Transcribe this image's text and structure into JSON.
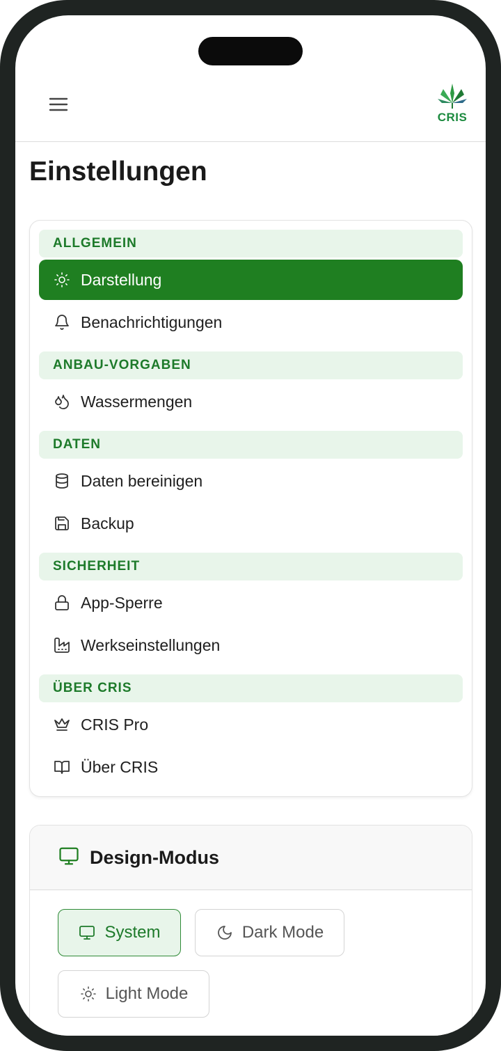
{
  "header": {
    "logo_text": "CRIS"
  },
  "page": {
    "title": "Einstellungen"
  },
  "menu": {
    "sections": [
      {
        "label": "ALLGEMEIN",
        "items": [
          {
            "label": "Darstellung",
            "icon": "sun-icon",
            "active": true
          },
          {
            "label": "Benachrichtigungen",
            "icon": "bell-icon"
          }
        ]
      },
      {
        "label": "ANBAU-VORGABEN",
        "items": [
          {
            "label": "Wassermengen",
            "icon": "droplets-icon"
          }
        ]
      },
      {
        "label": "DATEN",
        "items": [
          {
            "label": "Daten bereinigen",
            "icon": "database-icon"
          },
          {
            "label": "Backup",
            "icon": "save-icon"
          }
        ]
      },
      {
        "label": "SICHERHEIT",
        "items": [
          {
            "label": "App-Sperre",
            "icon": "lock-icon"
          },
          {
            "label": "Werkseinstellungen",
            "icon": "factory-icon"
          }
        ]
      },
      {
        "label": "ÜBER CRIS",
        "items": [
          {
            "label": "CRIS Pro",
            "icon": "crown-icon"
          },
          {
            "label": "Über CRIS",
            "icon": "book-icon"
          }
        ]
      }
    ]
  },
  "design_mode": {
    "title": "Design-Modus",
    "options": [
      {
        "label": "System",
        "icon": "monitor-icon",
        "selected": true
      },
      {
        "label": "Dark Mode",
        "icon": "moon-icon"
      },
      {
        "label": "Light Mode",
        "icon": "sun-icon"
      }
    ]
  },
  "colors": {
    "primary": "#1f7f21",
    "section_bg": "#e8f5ea",
    "section_text": "#1d7a2a"
  }
}
